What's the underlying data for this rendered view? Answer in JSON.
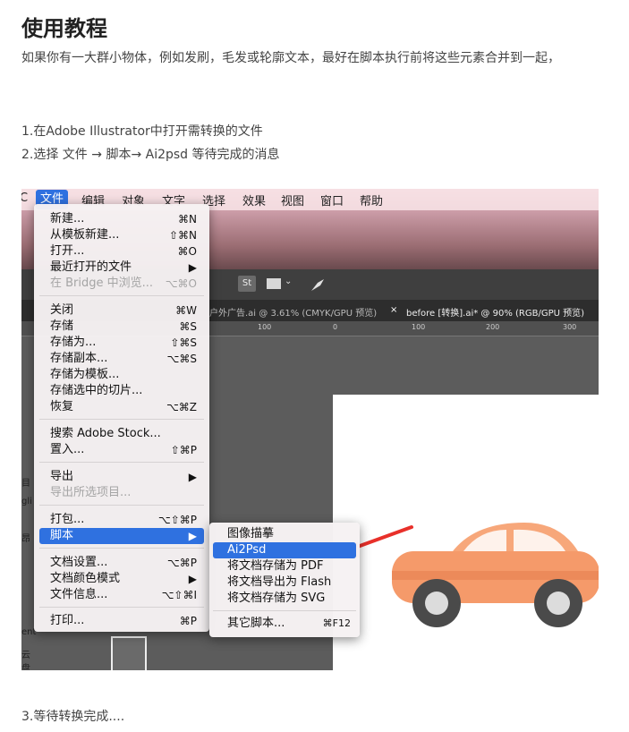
{
  "title": "使用教程",
  "intro": "如果你有一大群小物体，例如发刷，毛发或轮廓文本，最好在脚本执行前将这些元素合并到一起，",
  "steps": {
    "s1": "1.在Adobe Illustrator中打开需转换的文件",
    "s2": "2.选择 文件 → 脚本→ Ai2psd 等待完成的消息",
    "s3": "3.等待转换完成...."
  },
  "menubar": {
    "apple": "C",
    "file": "文件",
    "edit": "编辑",
    "object": "对象",
    "type": "文字",
    "select": "选择",
    "effect": "效果",
    "view": "视图",
    "window": "窗口",
    "help": "帮助"
  },
  "file_menu": [
    {
      "label": "新建...",
      "shortcut": "⌘N"
    },
    {
      "label": "从模板新建...",
      "shortcut": "⇧⌘N"
    },
    {
      "label": "打开...",
      "shortcut": "⌘O"
    },
    {
      "label": "最近打开的文件",
      "shortcut": "▶"
    },
    {
      "label": "在 Bridge 中浏览...",
      "shortcut": "⌥⌘O"
    },
    {
      "label": "关闭",
      "shortcut": "⌘W"
    },
    {
      "label": "存储",
      "shortcut": "⌘S"
    },
    {
      "label": "存储为...",
      "shortcut": "⇧⌘S"
    },
    {
      "label": "存储副本...",
      "shortcut": "⌥⌘S"
    },
    {
      "label": "存储为模板...",
      "shortcut": ""
    },
    {
      "label": "存储选中的切片...",
      "shortcut": ""
    },
    {
      "label": "恢复",
      "shortcut": "⌥⌘Z"
    },
    {
      "label": "搜索 Adobe Stock...",
      "shortcut": ""
    },
    {
      "label": "置入...",
      "shortcut": "⇧⌘P"
    },
    {
      "label": "导出",
      "shortcut": "▶"
    },
    {
      "label": "导出所选项目...",
      "shortcut": ""
    },
    {
      "label": "打包...",
      "shortcut": "⌥⇧⌘P"
    },
    {
      "label": "脚本",
      "shortcut": "▶"
    },
    {
      "label": "文档设置...",
      "shortcut": "⌥⌘P"
    },
    {
      "label": "文档颜色模式",
      "shortcut": "▶"
    },
    {
      "label": "文件信息...",
      "shortcut": "⌥⇧⌘I"
    },
    {
      "label": "打印...",
      "shortcut": "⌘P"
    }
  ],
  "script_menu": [
    {
      "label": "图像描摹",
      "shortcut": ""
    },
    {
      "label": "Ai2Psd",
      "shortcut": ""
    },
    {
      "label": "将文档存储为 PDF",
      "shortcut": ""
    },
    {
      "label": "将文档导出为 Flash",
      "shortcut": ""
    },
    {
      "label": "将文档存储为 SVG",
      "shortcut": ""
    },
    {
      "label": "其它脚本...",
      "shortcut": "⌘F12"
    }
  ],
  "toolbar": {
    "st": "St"
  },
  "tabs": {
    "tab1": "户外广告.ai @ 3.61% (CMYK/GPU 预览)",
    "tab2_close": "×",
    "tab2": "before [转换].ai* @ 90% (RGB/GPU 预览)"
  },
  "ruler": [
    "100",
    "0",
    "100",
    "200",
    "300"
  ],
  "side_labels": [
    "目",
    "gli",
    "昂",
    "ent",
    "云盘"
  ],
  "colors": {
    "accent": "#2f71e0",
    "arrow": "#e8302a",
    "car_body": "#f59a6a"
  }
}
